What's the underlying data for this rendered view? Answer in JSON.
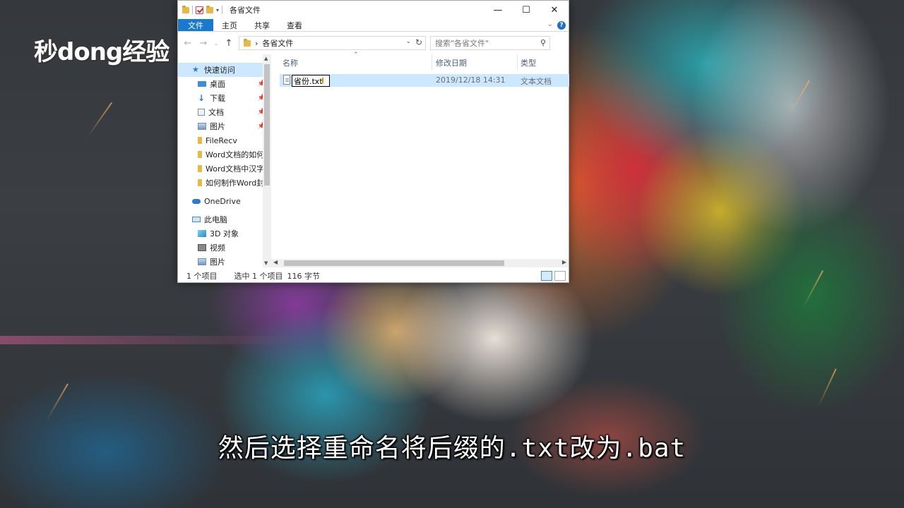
{
  "watermark": {
    "logo_text": "秒dong经验"
  },
  "subtitle": "然后选择重命名将后缀的.txt改为.bat",
  "window": {
    "title": "各省文件",
    "controls": {
      "minimize": "—",
      "maximize": "☐",
      "close": "✕"
    },
    "ribbon_tabs": [
      "文件",
      "主页",
      "共享",
      "查看"
    ],
    "help_label": "?",
    "address": {
      "path": "各省文件",
      "separator": "›"
    },
    "search": {
      "placeholder": "搜索\"各省文件\""
    },
    "nav_pane": [
      {
        "label": "快速访问",
        "icon": "star-icon",
        "selected": true
      },
      {
        "label": "桌面",
        "icon": "desktop-icon",
        "pinned": true
      },
      {
        "label": "下载",
        "icon": "download-icon",
        "pinned": true
      },
      {
        "label": "文档",
        "icon": "document-icon",
        "pinned": true
      },
      {
        "label": "图片",
        "icon": "picture-icon",
        "pinned": true
      },
      {
        "label": "FileRecv",
        "icon": "folder-icon"
      },
      {
        "label": "Word文档的如何",
        "icon": "folder-icon"
      },
      {
        "label": "Word文档中汉字",
        "icon": "folder-icon"
      },
      {
        "label": "如何制作Word封",
        "icon": "folder-icon"
      },
      {
        "label": "OneDrive",
        "icon": "cloud-icon"
      },
      {
        "label": "此电脑",
        "icon": "computer-icon"
      },
      {
        "label": "3D 对象",
        "icon": "cube-icon"
      },
      {
        "label": "视频",
        "icon": "video-icon"
      },
      {
        "label": "图片",
        "icon": "picture-icon"
      }
    ],
    "columns": {
      "name": "名称",
      "modified": "修改日期",
      "type": "类型"
    },
    "files": [
      {
        "name": "省份.txt",
        "modified": "2019/12/18 14:31",
        "type": "文本文档"
      }
    ],
    "status": {
      "count": "1 个项目",
      "selected": "选中 1 个项目",
      "size": "116 字节"
    }
  }
}
